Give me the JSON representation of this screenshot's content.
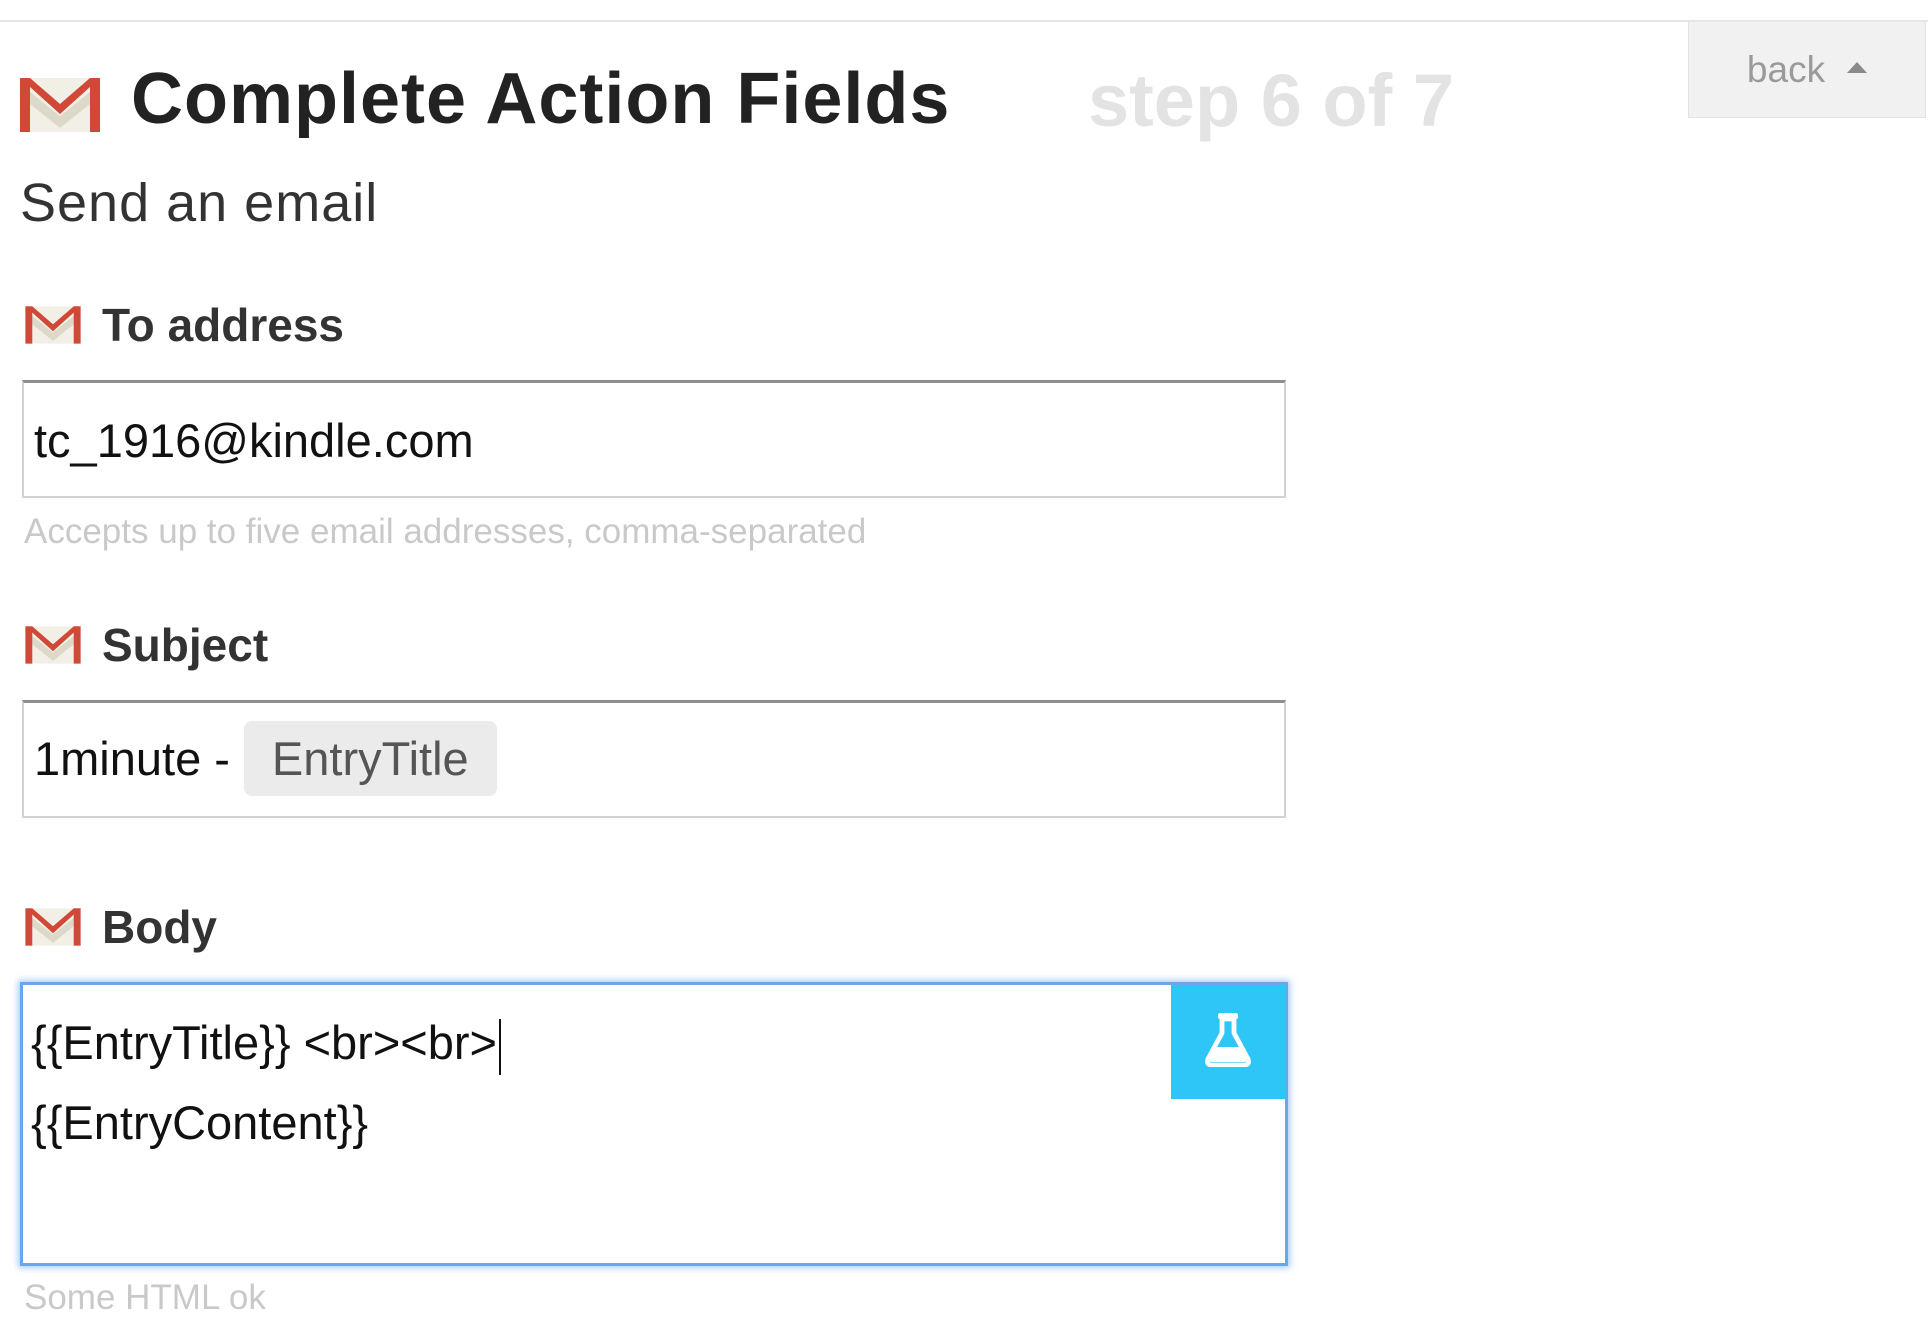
{
  "header": {
    "title": "Complete Action Fields",
    "step": "step 6 of 7",
    "subtitle": "Send an email",
    "back_label": "back",
    "icon": "gmail-icon"
  },
  "fields": {
    "to": {
      "label": "To address",
      "value": "tc_1916@kindle.com",
      "hint": "Accepts up to five email addresses, comma-separated",
      "icon": "gmail-icon"
    },
    "subject": {
      "label": "Subject",
      "prefix": "1minute -",
      "ingredient": "EntryTitle",
      "icon": "gmail-icon"
    },
    "body": {
      "label": "Body",
      "line1": "{{EntryTitle}} <br><br>",
      "line2": "{{EntryContent}}",
      "hint": "Some HTML ok",
      "icon": "gmail-icon",
      "ingredient_button_icon": "flask-icon"
    }
  },
  "colors": {
    "gmail_red": "#d14836",
    "accent_blue": "#2ec5f7",
    "focus_blue": "#6aa6ec",
    "step_gray": "#e3e3e3"
  }
}
